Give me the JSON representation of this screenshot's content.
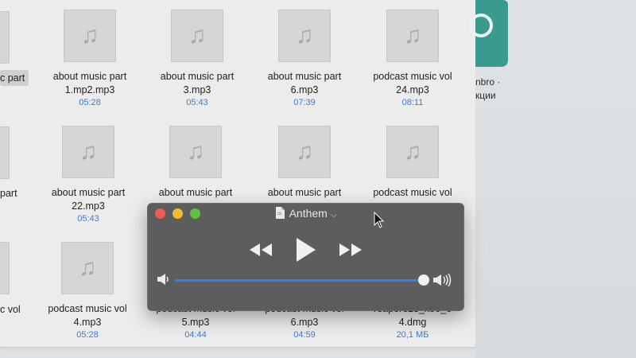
{
  "finder": {
    "files": [
      {
        "name": "about music part",
        "name2": "1.mp2.mp3",
        "meta": "05:28"
      },
      {
        "name": "about music part",
        "name2": "3.mp3",
        "meta": "05:43"
      },
      {
        "name": "about music part",
        "name2": "6.mp3",
        "meta": "07:39"
      },
      {
        "name": "podcast music vol",
        "name2": "24.mp3",
        "meta": "08:11"
      },
      {
        "name": "about music part",
        "name2": "22.mp3",
        "meta": "05:43"
      },
      {
        "name": "about music part",
        "name2": "",
        "meta": ""
      },
      {
        "name": "about music part",
        "name2": "",
        "meta": ""
      },
      {
        "name": "podcast music vol",
        "name2": "",
        "meta": ""
      },
      {
        "name": "podcast music vol",
        "name2": "4.mp3",
        "meta": "05:28"
      },
      {
        "name": "podcast music vol",
        "name2": "5.mp3",
        "meta": "04:44"
      },
      {
        "name": "podcast music vol",
        "name2": "6.mp3",
        "meta": "04:59"
      },
      {
        "name": "reaper623_x86_6",
        "name2": "4.dmg",
        "meta": "20,1 МБ"
      }
    ],
    "cut_labels": [
      "c part",
      "part",
      "c vol"
    ]
  },
  "desktop": {
    "label1": "nbro ·",
    "label2": "кции"
  },
  "player": {
    "title": "Anthem",
    "icons": {
      "rewind": "rewind-icon",
      "play": "play-icon",
      "fastforward": "fast-forward-icon",
      "volume_low": "volume-low-icon",
      "volume_high": "volume-high-icon"
    },
    "volume_level": 1.0
  }
}
